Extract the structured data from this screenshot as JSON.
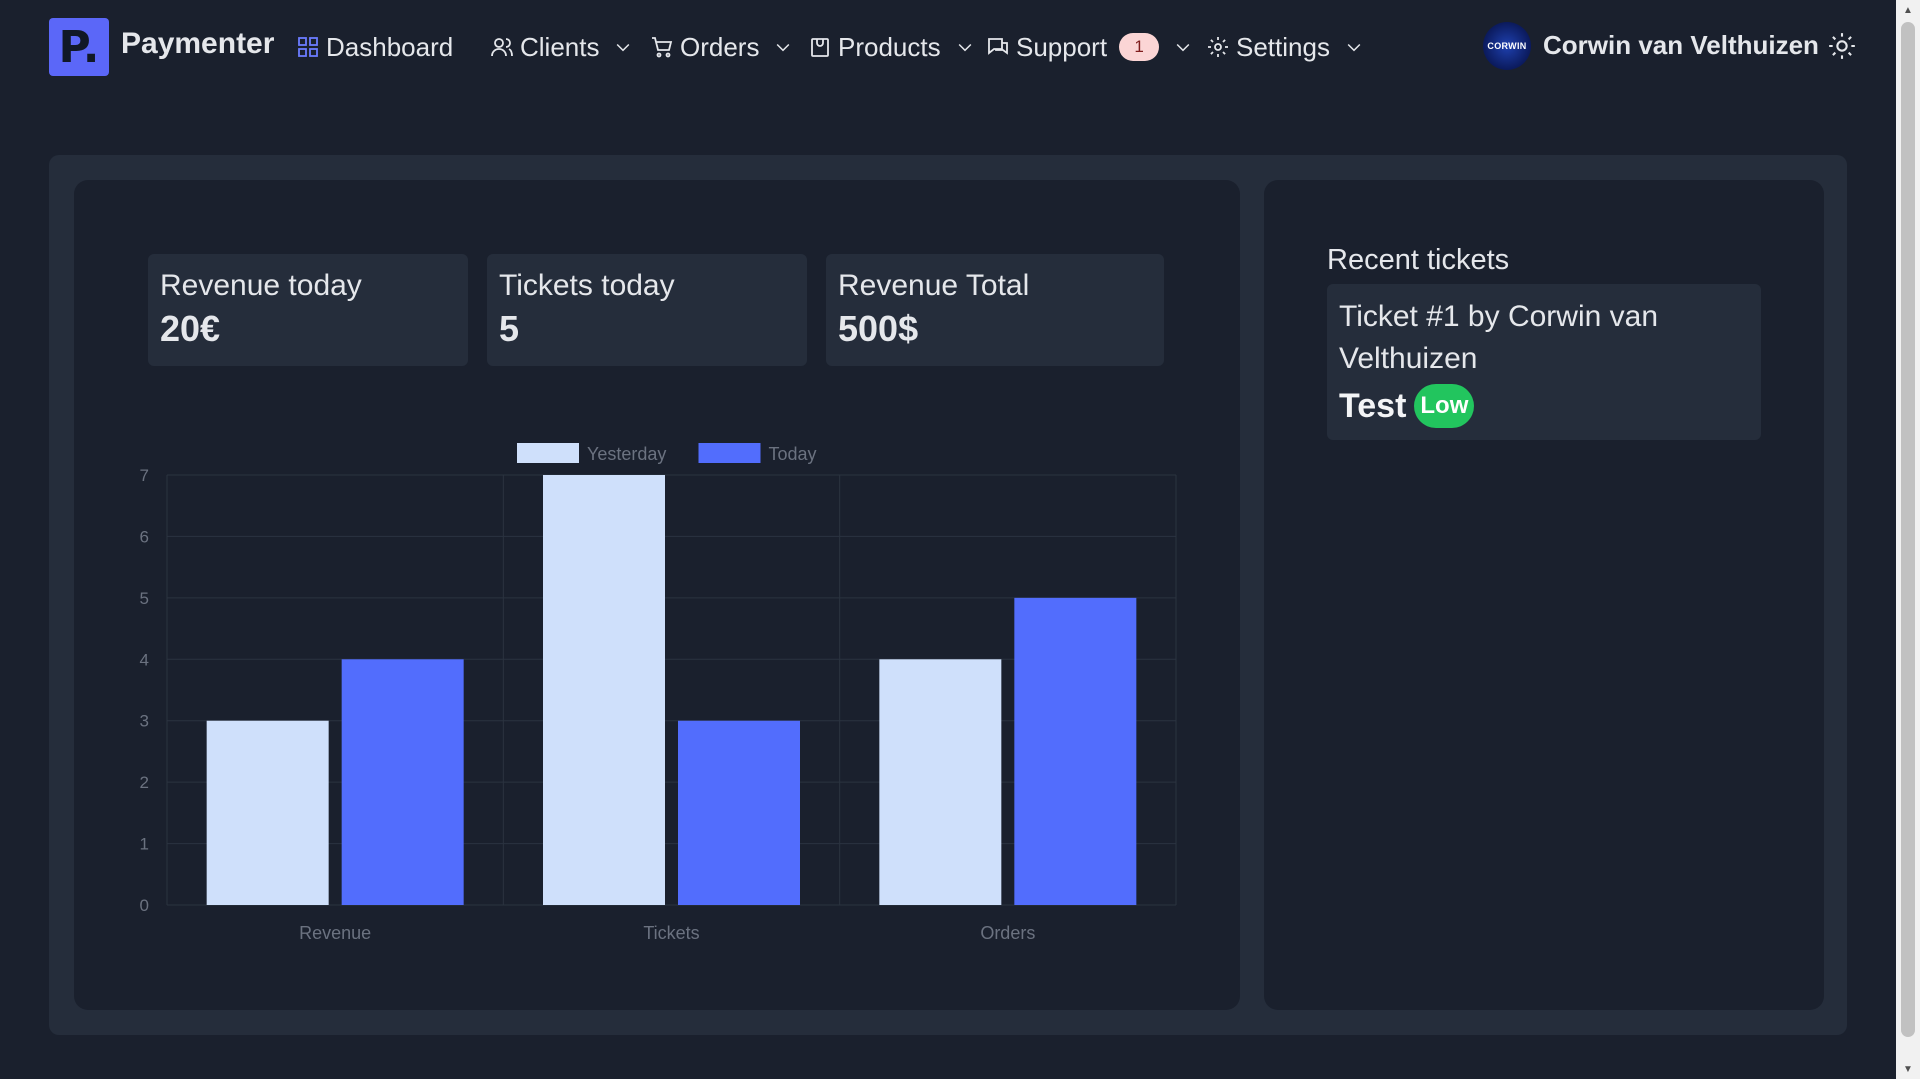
{
  "nav": {
    "logo_letter": "P.",
    "brand": "Paymenter",
    "dashboard": "Dashboard",
    "clients": "Clients",
    "orders": "Orders",
    "products": "Products",
    "support": "Support",
    "support_badge": "1",
    "settings": "Settings",
    "avatar_text": "CORWIN",
    "username": "Corwin van Velthuizen"
  },
  "stats": [
    {
      "label": "Revenue today",
      "value": "20€"
    },
    {
      "label": "Tickets today",
      "value": "5"
    },
    {
      "label": "Revenue Total",
      "value": "500$"
    }
  ],
  "recent": {
    "title": "Recent tickets",
    "ticket_title": "Ticket #1 by Corwin van Velthuizen",
    "ticket_subject": "Test",
    "ticket_priority": "Low"
  },
  "colors": {
    "yesterday": "#cfe0fb",
    "today": "#526dfd",
    "priority_low": "#22c55e",
    "accent": "#5b67f8"
  },
  "chart_data": {
    "type": "bar",
    "categories": [
      "Revenue",
      "Tickets",
      "Orders"
    ],
    "series": [
      {
        "name": "Yesterday",
        "values": [
          3,
          7,
          4
        ]
      },
      {
        "name": "Today",
        "values": [
          4,
          3,
          5
        ]
      }
    ],
    "ylim": [
      0,
      7
    ],
    "yticks": [
      0,
      1,
      2,
      3,
      4,
      5,
      6,
      7
    ],
    "legend": "top-center",
    "grid": true
  }
}
